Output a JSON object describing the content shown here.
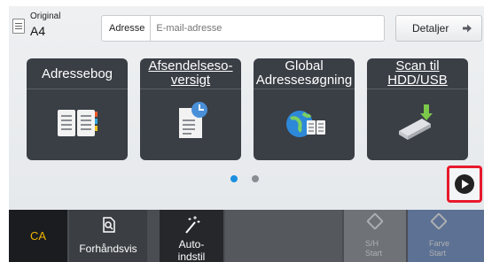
{
  "topbar": {
    "original_label": "Original",
    "original_value": "A4",
    "address_label": "Adresse",
    "address_placeholder": "E-mail-adresse",
    "details_label": "Detaljer"
  },
  "tiles": [
    {
      "line1": "Adressebog",
      "line2": ""
    },
    {
      "line1": "Afsendelseso-",
      "line2": "versigt"
    },
    {
      "line1": "Global",
      "line2": "Adressesøgning"
    },
    {
      "line1": "Scan til",
      "line2": "HDD/USB"
    }
  ],
  "pager": {
    "current": 1,
    "total": 2
  },
  "bottombar": {
    "ca_label": "CA",
    "preview_label": "Forhåndsvis",
    "auto_line1": "Auto-",
    "auto_line2": "indstil",
    "sw_start_line1": "S/H",
    "sw_start_line2": "Start",
    "color_start_line1": "Farve",
    "color_start_line2": "Start"
  },
  "colors": {
    "accent_blue": "#1a8fe0",
    "highlight_red": "#e8192c",
    "ca_text": "#f0b400"
  },
  "icons": {
    "original": "document-icon",
    "details": "arrow-right-icon",
    "address_book": "book-icon",
    "sending_history": "document-clock-icon",
    "global_search": "globe-book-icon",
    "scan_hdd": "usb-arrow-icon",
    "next_page": "play-icon",
    "preview": "magnifier-document-icon",
    "auto": "magic-wand-icon",
    "start": "start-diamond-icon"
  }
}
